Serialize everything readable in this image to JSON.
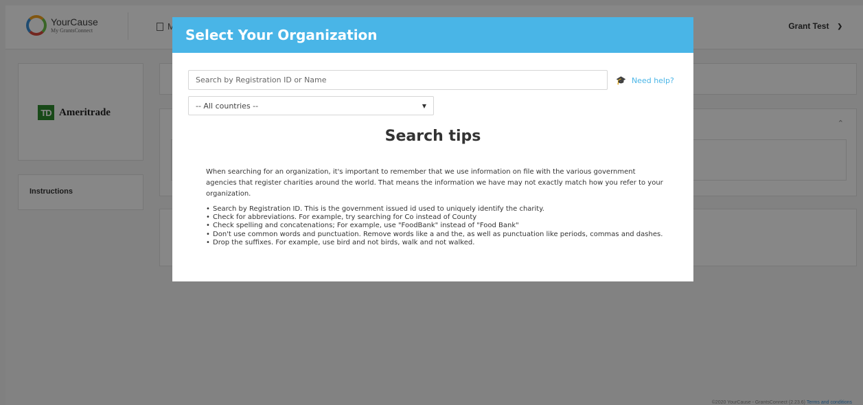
{
  "app": {
    "logo": {
      "name": "YourCause",
      "sub": "My GrantsConnect"
    },
    "nav_label": "M",
    "user_name": "Grant Test",
    "brand": {
      "mark": "TD",
      "name": "Ameritrade"
    },
    "instructions_label": "Instructions",
    "footer": {
      "text": "©2020 YourCause - GrantsConnect (2.23.6)",
      "link": "Terms and conditions"
    }
  },
  "modal": {
    "title": "Select Your Organization",
    "search_placeholder": "Search by Registration ID or Name",
    "help_label": "Need help?",
    "country_selected": "-- All countries --",
    "tips_title": "Search tips",
    "tips_intro": "When searching for an organization, it's important to remember that we use information on file with the various government agencies that register charities around the world. That means the information we have may not exactly match how you refer to your organization.",
    "tips": [
      "Search by Registration ID. This is the government issued id used to uniquely identify the charity.",
      "Check for abbreviations. For example, try searching for Co instead of County",
      "Check spelling and concatenations; For example, use \"FoodBank\" instead of \"Food Bank\"",
      "Don't use common words and punctuation. Remove words like a and the, as well as punctuation like periods, commas and dashes.",
      "Drop the suffixes. For example, use bird and not birds, walk and not walked."
    ]
  },
  "icons": {
    "help": "graduation-cap-icon",
    "user_menu": "chevron-down-icon",
    "select": "caret-down-icon",
    "nav": "document-icon",
    "collapse": "chevron-up-icon"
  },
  "colors": {
    "modal_header": "#49b5e7",
    "link": "#49b5e7",
    "overlay": "rgba(0,0,0,0.47)",
    "brand_green": "#2f8a2f"
  }
}
